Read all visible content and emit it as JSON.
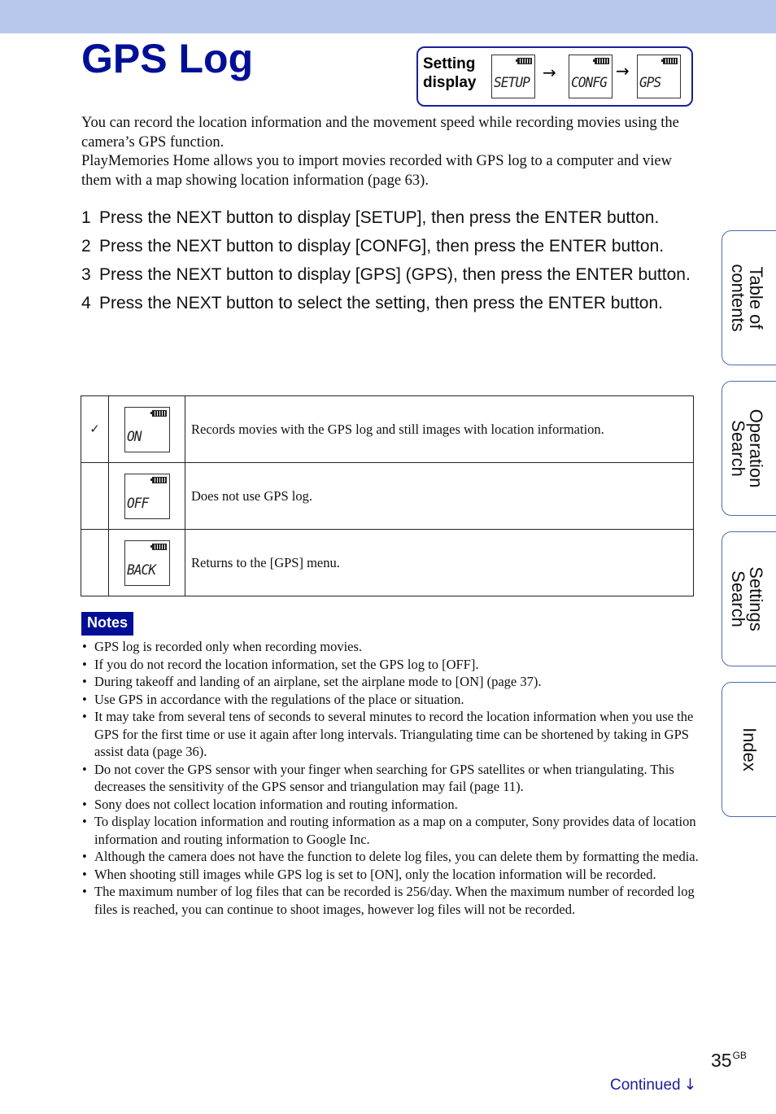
{
  "page": {
    "title": "GPS Log",
    "page_number": "35",
    "page_suffix": "GB",
    "continued_label": "Continued",
    "continued_icon": "arrow-down-icon"
  },
  "setting_display": {
    "label_line1": "Setting",
    "label_line2": "display",
    "screens": [
      "SETUP",
      "CONFG",
      "GPS"
    ],
    "arrow": "→"
  },
  "intro": [
    "You can record the location information and the movement speed while recording movies using the camera’s GPS function.",
    "PlayMemories Home allows you to import movies recorded with GPS log to a computer and view them with a map showing location information (page 63)."
  ],
  "steps": [
    {
      "num": "1",
      "text": "Press the NEXT button to display [SETUP], then press the ENTER button."
    },
    {
      "num": "2",
      "text": "Press the NEXT button to display [CONFG], then press the ENTER button."
    },
    {
      "num": "3",
      "text": "Press the NEXT button to display [GPS] (GPS), then press the ENTER button."
    },
    {
      "num": "4",
      "text": "Press the NEXT button to select the setting, then press the ENTER button."
    }
  ],
  "options": [
    {
      "default": "✓",
      "screen": "ON",
      "description": "Records movies with the GPS log and still images with location information."
    },
    {
      "default": "",
      "screen": "OFF",
      "description": "Does not use GPS log."
    },
    {
      "default": "",
      "screen": "BACK",
      "description": "Returns to the [GPS] menu."
    }
  ],
  "notes": {
    "label": "Notes",
    "items": [
      "GPS log is recorded only when recording movies.",
      "If you do not record the location information, set the GPS log to [OFF].",
      "During takeoff and landing of an airplane, set the airplane mode to [ON] (page 37).",
      "Use GPS in accordance with the regulations of the place or situation.",
      "It may take from several tens of seconds to several minutes to record the location information when you use the GPS for the first time or use it again after long intervals. Triangulating time can be shortened by taking in GPS assist data (page 36).",
      "Do not cover the GPS sensor with your finger when searching for GPS satellites or when triangulating. This decreases the sensitivity of the GPS sensor and triangulation may fail (page 11).",
      "Sony does not collect location information and routing information.",
      "To display location information and routing information as a map on a computer, Sony provides data of location information and routing information to Google Inc.",
      "Although the camera does not have the function to delete log files, you can delete them by formatting the media.",
      "When shooting still images while GPS log is set to [ON], only the location information will be recorded.",
      "The maximum number of log files that can be recorded is 256/day. When the maximum number of recorded log files is reached, you can continue to shoot images, however log files will not be recorded."
    ]
  },
  "side_tabs": [
    {
      "line1": "Table of",
      "line2": "contents"
    },
    {
      "line1": "Operation",
      "line2": "Search"
    },
    {
      "line1": "Settings",
      "line2": "Search"
    },
    {
      "line1": "Index",
      "line2": ""
    }
  ],
  "colors": {
    "brand_blue": "#000f96",
    "header_band": "#b8c8ec",
    "tab_border": "#4a6cb0"
  }
}
